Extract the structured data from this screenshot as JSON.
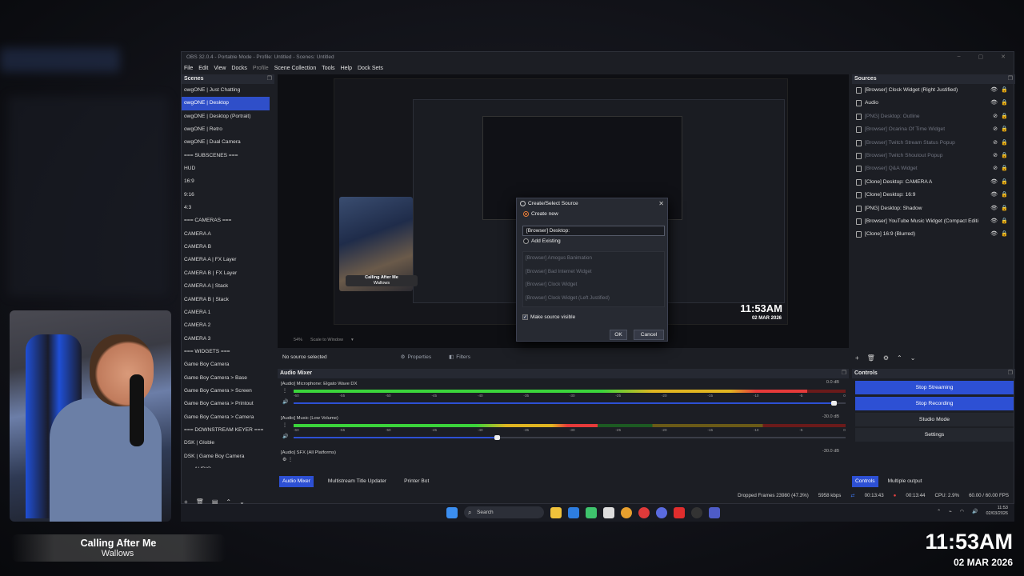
{
  "window": {
    "title": "OBS 32.0.4 - Portable Mode - Profile: Untitled - Scenes: Untitled"
  },
  "menu": [
    "File",
    "Edit",
    "View",
    "Docks",
    "Profile",
    "Scene Collection",
    "Tools",
    "Help",
    "Dock Sets"
  ],
  "scenes": {
    "header": "Scenes",
    "items": [
      "owgONE | Just Chatting",
      "owgONE | Desktop",
      "owgONE | Desktop (Portrait)",
      "owgONE | Retro",
      "owgONE | Dual Camera",
      "=== SUBSCENES ===",
      "HUD",
      "16:9",
      "9:16",
      "4:3",
      "=== CAMERAS ===",
      "CAMERA A",
      "CAMERA B",
      "CAMERA A | FX Layer",
      "CAMERA B | FX Layer",
      "CAMERA A | Stack",
      "CAMERA B | Stack",
      "CAMERA 1",
      "CAMERA 2",
      "CAMERA 3",
      "=== WIDGETS ===",
      "Game Boy Camera",
      "Game Boy Camera > Base",
      "Game Boy Camera > Screen",
      "Game Boy Camera > Printout",
      "Game Boy Camera > Camera",
      "=== DOWNSTREAM KEYER ===",
      "DSK | Globle",
      "DSK | Game Boy Camera",
      "=== AUDIO ==="
    ],
    "selected_index": 1
  },
  "preview": {
    "zoom": "54%",
    "scale_mode": "Scale to Window",
    "overlay_time": "11:53AM",
    "overlay_date": "02 MAR 2026",
    "cam_title": "Calling After Me",
    "cam_artist": "Wallows"
  },
  "dialog": {
    "title": "Create/Select Source",
    "create_new": "Create new",
    "name_value": "[Browser] Desktop:",
    "add_existing": "Add Existing",
    "existing": [
      "[Browser] Amogus Banimation",
      "[Browser] Bad Internet Widget",
      "[Browser] Clock Widget",
      "[Browser] Clock Widget (Left Justified)"
    ],
    "make_visible": "Make source visible",
    "ok": "OK",
    "cancel": "Cancel"
  },
  "source_status": {
    "text": "No source selected",
    "properties": "Properties",
    "filters": "Filters"
  },
  "mixer": {
    "header": "Audio Mixer",
    "channels": [
      {
        "name": "[Audio] Microphone: Elgato Wave DX",
        "db": "0.0 dB",
        "level": 0.93,
        "volume": 0.98
      },
      {
        "name": "[Audio] Music (Low Volume)",
        "db": "-30.0 dB",
        "level": 0.55,
        "volume": 0.37
      },
      {
        "name": "[Audio] SFX (All Platforms)",
        "db": "-30.0 dB",
        "level": 0,
        "volume": 0
      }
    ],
    "ticks": [
      "-60",
      "-55",
      "-50",
      "-45",
      "-40",
      "-35",
      "-30",
      "-25",
      "-20",
      "-15",
      "-10",
      "-5",
      "0"
    ]
  },
  "bottom_tabs": [
    "Audio Mixer",
    "Multistream Title Updater",
    "Printer Bot"
  ],
  "sources": {
    "header": "Sources",
    "items": [
      {
        "label": "[Browser] Clock Widget (Right Justified)",
        "visible": true
      },
      {
        "label": "Audio",
        "visible": true
      },
      {
        "label": "[PNG] Desktop: Outline",
        "visible": false
      },
      {
        "label": "[Browser] Ocarina Of Time Widget",
        "visible": false
      },
      {
        "label": "[Browser] Twitch Stream Status Popup",
        "visible": false
      },
      {
        "label": "[Browser] Twitch Shoutout Popup",
        "visible": false
      },
      {
        "label": "[Browser] Q&A Widget",
        "visible": false
      },
      {
        "label": "[Clone] Desktop: CAMERA A",
        "visible": true
      },
      {
        "label": "[Clone] Desktop: 16:9",
        "visible": true
      },
      {
        "label": "[PNG] Desktop: Shadow",
        "visible": true
      },
      {
        "label": "[Browser] YouTube Music Widget (Compact Editi",
        "visible": true
      },
      {
        "label": "[Clone] 16:9 (Blurred)",
        "visible": true
      }
    ]
  },
  "controls": {
    "header": "Controls",
    "buttons": [
      "Stop Streaming",
      "Stop Recording",
      "Studio Mode",
      "Settings"
    ],
    "tabs": [
      "Controls",
      "Multiple output"
    ]
  },
  "status": {
    "dropped": "Dropped Frames 23980 (47.3%)",
    "bitrate": "5958 kbps",
    "stream_time": "00:13:43",
    "rec_time": "00:13:44",
    "cpu": "CPU: 2.9%",
    "fps": "60.00 / 60.00 FPS"
  },
  "taskbar": {
    "search": "Search",
    "time": "11:53",
    "date": "02/03/2026"
  },
  "overlay": {
    "song_title": "Calling After Me",
    "song_artist": "Wallows",
    "clock": "11:53AM",
    "date": "02 MAR 2026"
  },
  "colors": {
    "accent": "#2d50d4",
    "record": "#e54040",
    "dialog_radio": "#e57e3d"
  }
}
